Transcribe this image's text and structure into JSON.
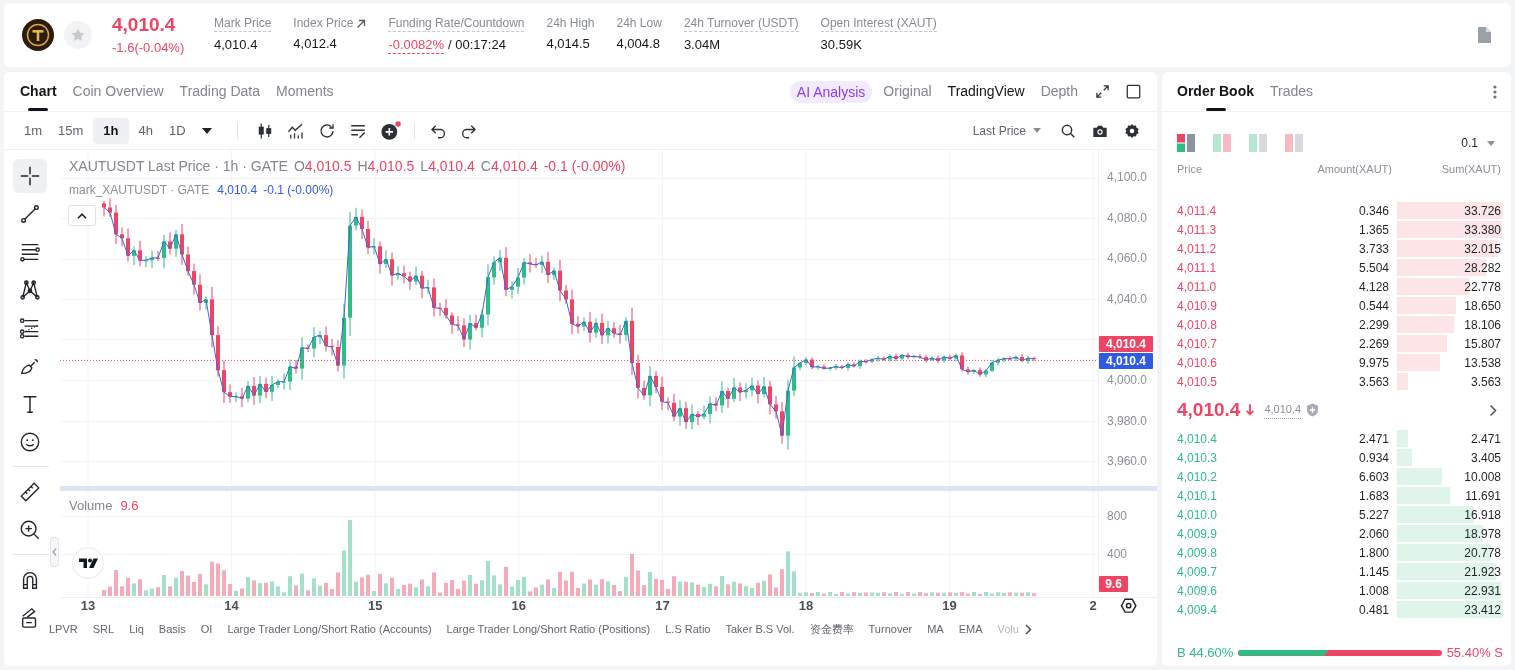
{
  "header": {
    "favorite": false,
    "price": "4,010.4",
    "change": "-1.6(-0.04%)",
    "falling": true,
    "stats": [
      {
        "label": "Mark Price",
        "value": "4,010.4",
        "kind": "hint",
        "negative": false
      },
      {
        "label": "Index Price",
        "value": "4,012.4",
        "kind": "link",
        "negative": false
      },
      {
        "label": "Funding Rate/Countdown",
        "value": "-0.0082%",
        "extra": "/ 00:17:24",
        "kind": "hint",
        "negative": true
      },
      {
        "label": "24h High",
        "value": "4,014.5",
        "kind": "plain",
        "negative": false
      },
      {
        "label": "24h Low",
        "value": "4,004.8",
        "kind": "plain",
        "negative": false
      },
      {
        "label": "24h Turnover (USDT)",
        "value": "3.04M",
        "kind": "hint",
        "negative": false
      },
      {
        "label": "Open Interest (XAUT)",
        "value": "30.59K",
        "kind": "hint",
        "negative": false
      }
    ]
  },
  "chart_panel": {
    "tabs": [
      {
        "label": "Chart",
        "selected": true
      },
      {
        "label": "Coin Overview",
        "selected": false
      },
      {
        "label": "Trading Data",
        "selected": false
      },
      {
        "label": "Moments",
        "selected": false
      }
    ],
    "ai_button": "AI Analysis",
    "views": [
      {
        "label": "Original",
        "selected": false
      },
      {
        "label": "TradingView",
        "selected": true
      },
      {
        "label": "Depth",
        "selected": false
      }
    ],
    "intervals": [
      {
        "label": "1m",
        "selected": false
      },
      {
        "label": "15m",
        "selected": false
      },
      {
        "label": "1h",
        "selected": true
      },
      {
        "label": "4h",
        "selected": false
      },
      {
        "label": "1D",
        "selected": false
      }
    ],
    "price_source": "Last Price",
    "tool_groups": [
      {
        "tools": [
          {
            "kind": "crosshair",
            "selected": true
          },
          {
            "kind": "trend-line",
            "selected": false
          },
          {
            "kind": "horizontal-lines",
            "selected": false
          },
          {
            "kind": "pattern",
            "selected": false
          },
          {
            "kind": "fibonacci",
            "selected": false
          },
          {
            "kind": "brush",
            "selected": false
          },
          {
            "kind": "text",
            "selected": false
          },
          {
            "kind": "emoji",
            "selected": false
          }
        ]
      },
      {
        "tools": [
          {
            "kind": "ruler",
            "selected": false
          },
          {
            "kind": "zoom",
            "selected": false
          }
        ]
      },
      {
        "tools": [
          {
            "kind": "magnet",
            "selected": false
          },
          {
            "kind": "eraser",
            "selected": false
          }
        ]
      }
    ],
    "legend": {
      "title": "XAUTUSDT Last Price · 1h · GATE",
      "ohlc": [
        {
          "key": "O",
          "value": "4,010.5"
        },
        {
          "key": "H",
          "value": "4,010.5"
        },
        {
          "key": "L",
          "value": "4,010.4"
        },
        {
          "key": "C",
          "value": "4,010.4"
        }
      ],
      "change": "-0.1 (-0.00%)",
      "falling": true
    },
    "mark_legend": {
      "title": "mark_XAUTUSDT · GATE",
      "value": "4,010.4",
      "change": "-0.1 (-0.00%)"
    },
    "price_axis": [
      "4,100.0",
      "4,080.0",
      "4,060.0",
      "4,040.0",
      "4,000.0",
      "3,980.0",
      "3,960.0"
    ],
    "last_price_tag": "4,010.4",
    "mark_price_tag": "4,010.4",
    "volume": {
      "label": "Volume",
      "value": "9.6",
      "axis": [
        "800",
        "400"
      ],
      "tag": "9.6"
    },
    "date_axis": [
      "13",
      "14",
      "15",
      "16",
      "17",
      "18",
      "19",
      "2"
    ],
    "indicators": [
      "LPVR",
      "SRL",
      "Liq",
      "Basis",
      "OI",
      "Large Trader Long/Short Ratio (Accounts)",
      "Large Trader Long/Short Ratio (Positions)",
      "L.S Ratio",
      "Taker B.S Vol.",
      "资金费率",
      "Turnover",
      "MA",
      "EMA",
      "Volu"
    ]
  },
  "order_book": {
    "tabs": [
      {
        "label": "Order Book",
        "selected": true
      },
      {
        "label": "Trades",
        "selected": false
      }
    ],
    "layouts": [
      {
        "kind": "combined",
        "selected": true
      },
      {
        "kind": "split",
        "selected": false
      },
      {
        "kind": "bids",
        "selected": false
      },
      {
        "kind": "asks",
        "selected": false
      }
    ],
    "precision": "0.1",
    "columns": [
      "Price",
      "Amount(XAUT)",
      "Sum(XAUT)"
    ],
    "asks": [
      {
        "price": "4,011.4",
        "amount": "0.346",
        "sum": "33.726"
      },
      {
        "price": "4,011.3",
        "amount": "1.365",
        "sum": "33.380"
      },
      {
        "price": "4,011.2",
        "amount": "3.733",
        "sum": "32.015"
      },
      {
        "price": "4,011.1",
        "amount": "5.504",
        "sum": "28.282"
      },
      {
        "price": "4,011.0",
        "amount": "4.128",
        "sum": "22.778"
      },
      {
        "price": "4,010.9",
        "amount": "0.544",
        "sum": "18.650"
      },
      {
        "price": "4,010.8",
        "amount": "2.299",
        "sum": "18.106"
      },
      {
        "price": "4,010.7",
        "amount": "2.269",
        "sum": "15.807"
      },
      {
        "price": "4,010.6",
        "amount": "9.975",
        "sum": "13.538"
      },
      {
        "price": "4,010.5",
        "amount": "3.563",
        "sum": "3.563"
      }
    ],
    "mid": {
      "price": "4,010.4",
      "falling": true,
      "mark_price": "4,010.4"
    },
    "bids": [
      {
        "price": "4,010.4",
        "amount": "2.471",
        "sum": "2.471"
      },
      {
        "price": "4,010.3",
        "amount": "0.934",
        "sum": "3.405"
      },
      {
        "price": "4,010.2",
        "amount": "6.603",
        "sum": "10.008"
      },
      {
        "price": "4,010.1",
        "amount": "1.683",
        "sum": "11.691"
      },
      {
        "price": "4,010.0",
        "amount": "5.227",
        "sum": "16.918"
      },
      {
        "price": "4,009.9",
        "amount": "2.060",
        "sum": "18.978"
      },
      {
        "price": "4,009.8",
        "amount": "1.800",
        "sum": "20.778"
      },
      {
        "price": "4,009.7",
        "amount": "1.145",
        "sum": "21.923"
      },
      {
        "price": "4,009.6",
        "amount": "1.008",
        "sum": "22.931"
      },
      {
        "price": "4,009.4",
        "amount": "0.481",
        "sum": "23.412"
      }
    ],
    "ratio": {
      "buy": "B 44.60%",
      "sell": "55.40% S",
      "level": 0.446
    }
  }
}
